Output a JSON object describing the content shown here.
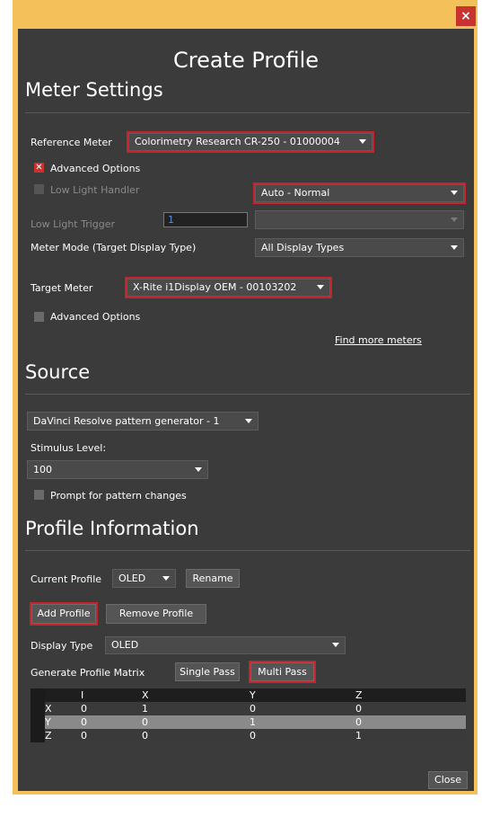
{
  "window": {
    "close_glyph": "×",
    "title": "Create Profile"
  },
  "meter_settings": {
    "heading": "Meter Settings",
    "reference_meter_label": "Reference Meter",
    "reference_meter_value": "Colorimetry Research CR-250 - 01000004",
    "advanced_options_label": "Advanced Options",
    "advanced_options_checked": true,
    "low_light_handler_label": "Low Light Handler",
    "low_light_handler_value": "Auto - Normal",
    "low_light_trigger_label": "Low Light Trigger",
    "low_light_trigger_value": "1",
    "low_light_trigger_select": "",
    "meter_mode_label": "Meter Mode (Target Display Type)",
    "meter_mode_value": "All Display Types",
    "target_meter_label": "Target Meter",
    "target_meter_value": "X-Rite i1Display OEM - 00103202",
    "target_advanced_options_label": "Advanced Options",
    "target_advanced_options_checked": false,
    "find_more_meters": "Find more meters"
  },
  "source": {
    "heading": "Source",
    "generator_value": "DaVinci Resolve pattern generator - 1",
    "stimulus_label": "Stimulus Level:",
    "stimulus_value": "100",
    "prompt_label": "Prompt for pattern changes",
    "prompt_checked": false
  },
  "profile_info": {
    "heading": "Profile Information",
    "current_profile_label": "Current Profile",
    "current_profile_value": "OLED",
    "rename_label": "Rename",
    "add_profile_label": "Add Profile",
    "remove_profile_label": "Remove Profile",
    "display_type_label": "Display Type",
    "display_type_value": "OLED",
    "generate_matrix_label": "Generate Profile Matrix",
    "single_pass_label": "Single Pass",
    "multi_pass_label": "Multi Pass"
  },
  "matrix": {
    "headers": [
      "",
      "I",
      "X",
      "Y",
      "Z"
    ],
    "rows": [
      {
        "label": "X",
        "i": "0",
        "x": "1",
        "y": "0",
        "z": "0"
      },
      {
        "label": "Y",
        "i": "0",
        "x": "0",
        "y": "1",
        "z": "0"
      },
      {
        "label": "Z",
        "i": "0",
        "x": "0",
        "y": "0",
        "z": "1"
      }
    ]
  },
  "footer": {
    "close_label": "Close"
  },
  "colors": {
    "accent_red": "#c4252c",
    "title_bar": "#f3c05a",
    "panel": "#3b3b3b"
  }
}
